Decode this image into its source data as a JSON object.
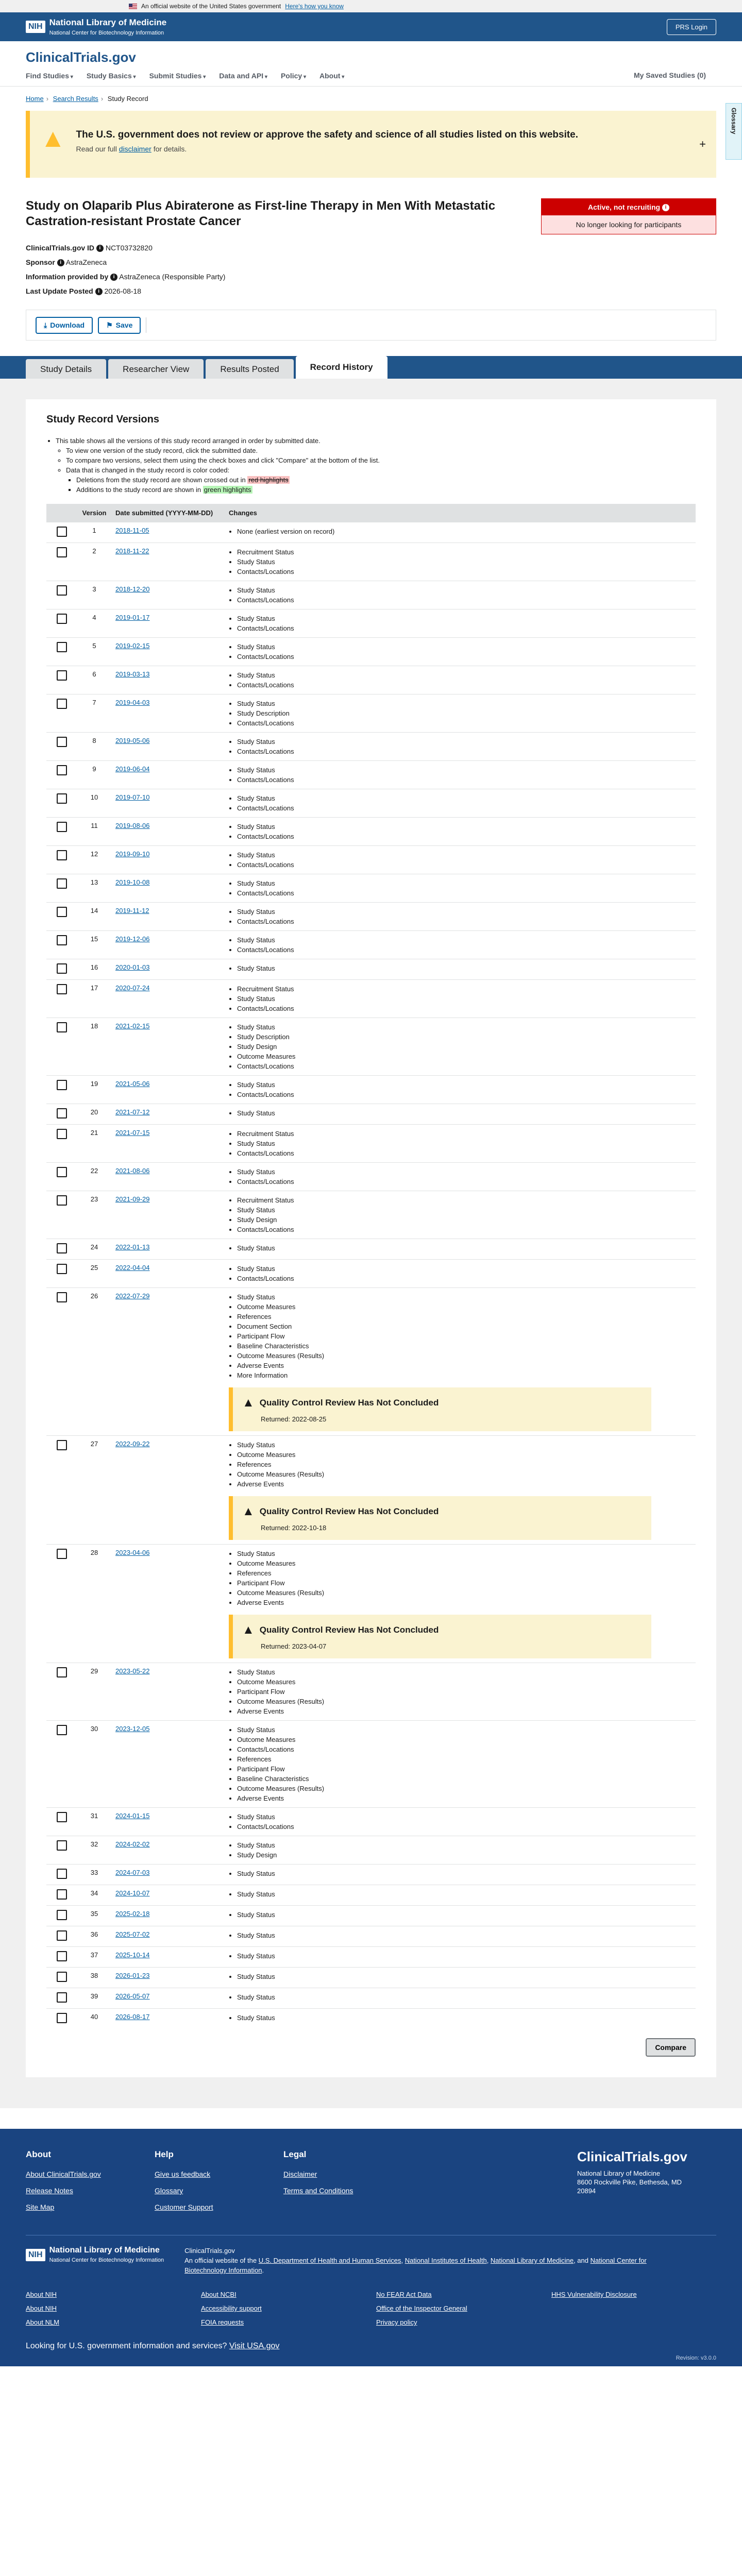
{
  "gov_banner": {
    "text": "An official website of the United States government",
    "link": "Here's how you know"
  },
  "nih": {
    "logo": "NIH",
    "name": "National Library of Medicine",
    "sub": "National Center for Biotechnology Information",
    "prs": "PRS Login"
  },
  "header": {
    "logo": "ClinicalTrials.gov",
    "nav": [
      "Find Studies",
      "Study Basics",
      "Submit Studies",
      "Data and API",
      "Policy",
      "About"
    ],
    "saved": "My Saved Studies (0)",
    "glossary": "Glossary"
  },
  "breadcrumb": [
    "Home",
    "Search Results",
    "Study Record"
  ],
  "alert": {
    "title": "The U.S. government does not review or approve the safety and science of all studies listed on this website.",
    "pre": "Read our full",
    "link": "disclaimer",
    "post": "for details."
  },
  "study": {
    "title": "Study on Olaparib Plus Abiraterone as First-line Therapy in Men With Metastatic Castration-resistant Prostate Cancer",
    "status": "Active, not recruiting",
    "status_sub": "No longer looking for participants",
    "id_label": "ClinicalTrials.gov ID",
    "id": "NCT03732820",
    "sponsor_label": "Sponsor",
    "sponsor": "AstraZeneca",
    "info_label": "Information provided by",
    "info": "AstraZeneca (Responsible Party)",
    "last_label": "Last Update Posted",
    "last": "2026-08-18"
  },
  "actions": {
    "download": "Download",
    "save": "Save"
  },
  "tabs": [
    "Study Details",
    "Researcher View",
    "Results Posted",
    "Record History"
  ],
  "history": {
    "title": "Study Record Versions",
    "intro1": "This table shows all the versions of this study record arranged in order by submitted date.",
    "intro2": "To view one version of the study record, click the submitted date.",
    "intro3": "To compare two versions, select them using the check boxes and click \"Compare\" at the bottom of the list.",
    "intro4": "Data that is changed in the study record is color coded:",
    "intro5a": "Deletions from the study record are shown crossed out in",
    "intro5b": "red highlights",
    "intro6a": "Additions to the study record are shown in",
    "intro6b": "green highlights",
    "col_version": "Version",
    "col_date": "Date submitted (YYYY-MM-DD)",
    "col_changes": "Changes",
    "qc_title": "Quality Control Review Has Not Concluded",
    "qc_returned": "Returned:",
    "compare": "Compare",
    "rows": [
      {
        "v": "1",
        "d": "2018-11-05",
        "c": [
          "None (earliest version on record)"
        ]
      },
      {
        "v": "2",
        "d": "2018-11-22",
        "c": [
          "Recruitment Status",
          "Study Status",
          "Contacts/Locations"
        ]
      },
      {
        "v": "3",
        "d": "2018-12-20",
        "c": [
          "Study Status",
          "Contacts/Locations"
        ]
      },
      {
        "v": "4",
        "d": "2019-01-17",
        "c": [
          "Study Status",
          "Contacts/Locations"
        ]
      },
      {
        "v": "5",
        "d": "2019-02-15",
        "c": [
          "Study Status",
          "Contacts/Locations"
        ]
      },
      {
        "v": "6",
        "d": "2019-03-13",
        "c": [
          "Study Status",
          "Contacts/Locations"
        ]
      },
      {
        "v": "7",
        "d": "2019-04-03",
        "c": [
          "Study Status",
          "Study Description",
          "Contacts/Locations"
        ]
      },
      {
        "v": "8",
        "d": "2019-05-06",
        "c": [
          "Study Status",
          "Contacts/Locations"
        ]
      },
      {
        "v": "9",
        "d": "2019-06-04",
        "c": [
          "Study Status",
          "Contacts/Locations"
        ]
      },
      {
        "v": "10",
        "d": "2019-07-10",
        "c": [
          "Study Status",
          "Contacts/Locations"
        ]
      },
      {
        "v": "11",
        "d": "2019-08-06",
        "c": [
          "Study Status",
          "Contacts/Locations"
        ]
      },
      {
        "v": "12",
        "d": "2019-09-10",
        "c": [
          "Study Status",
          "Contacts/Locations"
        ]
      },
      {
        "v": "13",
        "d": "2019-10-08",
        "c": [
          "Study Status",
          "Contacts/Locations"
        ]
      },
      {
        "v": "14",
        "d": "2019-11-12",
        "c": [
          "Study Status",
          "Contacts/Locations"
        ]
      },
      {
        "v": "15",
        "d": "2019-12-06",
        "c": [
          "Study Status",
          "Contacts/Locations"
        ]
      },
      {
        "v": "16",
        "d": "2020-01-03",
        "c": [
          "Study Status"
        ]
      },
      {
        "v": "17",
        "d": "2020-07-24",
        "c": [
          "Recruitment Status",
          "Study Status",
          "Contacts/Locations"
        ]
      },
      {
        "v": "18",
        "d": "2021-02-15",
        "c": [
          "Study Status",
          "Study Description",
          "Study Design",
          "Outcome Measures",
          "Contacts/Locations"
        ]
      },
      {
        "v": "19",
        "d": "2021-05-06",
        "c": [
          "Study Status",
          "Contacts/Locations"
        ]
      },
      {
        "v": "20",
        "d": "2021-07-12",
        "c": [
          "Study Status"
        ]
      },
      {
        "v": "21",
        "d": "2021-07-15",
        "c": [
          "Recruitment Status",
          "Study Status",
          "Contacts/Locations"
        ]
      },
      {
        "v": "22",
        "d": "2021-08-06",
        "c": [
          "Study Status",
          "Contacts/Locations"
        ]
      },
      {
        "v": "23",
        "d": "2021-09-29",
        "c": [
          "Recruitment Status",
          "Study Status",
          "Study Design",
          "Contacts/Locations"
        ]
      },
      {
        "v": "24",
        "d": "2022-01-13",
        "c": [
          "Study Status"
        ]
      },
      {
        "v": "25",
        "d": "2022-04-04",
        "c": [
          "Study Status",
          "Contacts/Locations"
        ]
      },
      {
        "v": "26",
        "d": "2022-07-29",
        "c": [
          "Study Status",
          "Outcome Measures",
          "References",
          "Document Section",
          "Participant Flow",
          "Baseline Characteristics",
          "Outcome Measures (Results)",
          "Adverse Events",
          "More Information"
        ],
        "qc": "2022-08-25"
      },
      {
        "v": "27",
        "d": "2022-09-22",
        "c": [
          "Study Status",
          "Outcome Measures",
          "References",
          "Outcome Measures (Results)",
          "Adverse Events"
        ],
        "qc": "2022-10-18"
      },
      {
        "v": "28",
        "d": "2023-04-06",
        "c": [
          "Study Status",
          "Outcome Measures",
          "References",
          "Participant Flow",
          "Outcome Measures (Results)",
          "Adverse Events"
        ],
        "qc": "2023-04-07"
      },
      {
        "v": "29",
        "d": "2023-05-22",
        "c": [
          "Study Status",
          "Outcome Measures",
          "Participant Flow",
          "Outcome Measures (Results)",
          "Adverse Events"
        ]
      },
      {
        "v": "30",
        "d": "2023-12-05",
        "c": [
          "Study Status",
          "Outcome Measures",
          "Contacts/Locations",
          "References",
          "Participant Flow",
          "Baseline Characteristics",
          "Outcome Measures (Results)",
          "Adverse Events"
        ]
      },
      {
        "v": "31",
        "d": "2024-01-15",
        "c": [
          "Study Status",
          "Contacts/Locations"
        ]
      },
      {
        "v": "32",
        "d": "2024-02-02",
        "c": [
          "Study Status",
          "Study Design"
        ]
      },
      {
        "v": "33",
        "d": "2024-07-03",
        "c": [
          "Study Status"
        ]
      },
      {
        "v": "34",
        "d": "2024-10-07",
        "c": [
          "Study Status"
        ]
      },
      {
        "v": "35",
        "d": "2025-02-18",
        "c": [
          "Study Status"
        ]
      },
      {
        "v": "36",
        "d": "2025-07-02",
        "c": [
          "Study Status"
        ]
      },
      {
        "v": "37",
        "d": "2025-10-14",
        "c": [
          "Study Status"
        ]
      },
      {
        "v": "38",
        "d": "2026-01-23",
        "c": [
          "Study Status"
        ]
      },
      {
        "v": "39",
        "d": "2026-05-07",
        "c": [
          "Study Status"
        ]
      },
      {
        "v": "40",
        "d": "2026-08-17",
        "c": [
          "Study Status"
        ]
      }
    ]
  },
  "footer": {
    "about": {
      "h": "About",
      "links": [
        "About ClinicalTrials.gov",
        "Release Notes",
        "Site Map"
      ]
    },
    "help": {
      "h": "Help",
      "links": [
        "Give us feedback",
        "Glossary",
        "Customer Support"
      ]
    },
    "legal": {
      "h": "Legal",
      "links": [
        "Disclaimer",
        "Terms and Conditions"
      ]
    },
    "logo": "ClinicalTrials.gov",
    "addr1": "National Library of Medicine",
    "addr2": "8600 Rockville Pike, Bethesda, MD 20894",
    "nih_name": "National Library of Medicine",
    "nih_sub": "National Center for Biotechnology Information",
    "official1": "ClinicalTrials.gov",
    "official2": "An official website of the",
    "official_links": [
      "U.S. Department of Health and Human Services",
      "National Institutes of Health",
      "National Library of Medicine"
    ],
    "official3": "and",
    "official4": "National Center for Biotechnology Information",
    "links": [
      "About NIH",
      "About NCBI",
      "No FEAR Act Data",
      "HHS Vulnerability Disclosure",
      "About NIH",
      "Accessibility support",
      "Office of the Inspector General",
      "",
      "About NLM",
      "FOIA requests",
      "Privacy policy",
      ""
    ],
    "usagov_q": "Looking for U.S. government information and services?",
    "usagov_link": "Visit USA.gov",
    "revision": "Revision: v3.0.0"
  }
}
